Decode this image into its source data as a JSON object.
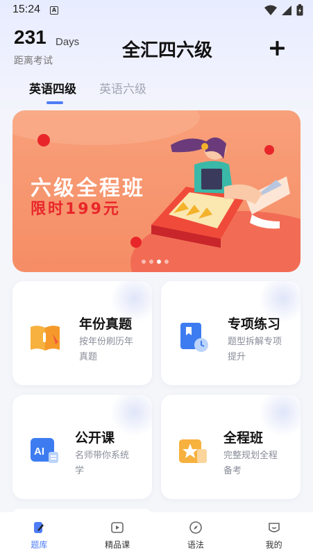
{
  "status_bar": {
    "time": "15:24",
    "a_badge": "A"
  },
  "header": {
    "days_count": "231",
    "days_unit": "Days",
    "days_caption": "距离考试",
    "title": "全汇四六级"
  },
  "tabs": [
    {
      "label": "英语四级",
      "active": true
    },
    {
      "label": "英语六级",
      "active": false
    }
  ],
  "banner": {
    "title": "六级全程班",
    "subtitle": "限时199元",
    "pages": 4,
    "active_page": 3
  },
  "cards": [
    {
      "title": "年份真题",
      "desc_line1": "按年份刷历年",
      "desc_line2": "真题",
      "icon": "book-icon"
    },
    {
      "title": "专项练习",
      "desc_line1": "题型拆解专项",
      "desc_line2": "提升",
      "icon": "bookmark-clock-icon"
    },
    {
      "title": "公开课",
      "desc_line1": "名师带你系统",
      "desc_line2": "学",
      "icon": "ai-course-icon"
    },
    {
      "title": "全程班",
      "desc_line1": "完整规划全程",
      "desc_line2": "备考",
      "icon": "star-badge-icon"
    }
  ],
  "bottom_nav": [
    {
      "label": "题库",
      "icon": "edit-icon",
      "active": true
    },
    {
      "label": "精品课",
      "icon": "play-icon",
      "active": false
    },
    {
      "label": "语法",
      "icon": "compass-icon",
      "active": false
    },
    {
      "label": "我的",
      "icon": "profile-icon",
      "active": false
    }
  ],
  "colors": {
    "accent": "#4f7cf6",
    "banner": "#f58d66",
    "banner_red": "#e8262a"
  }
}
